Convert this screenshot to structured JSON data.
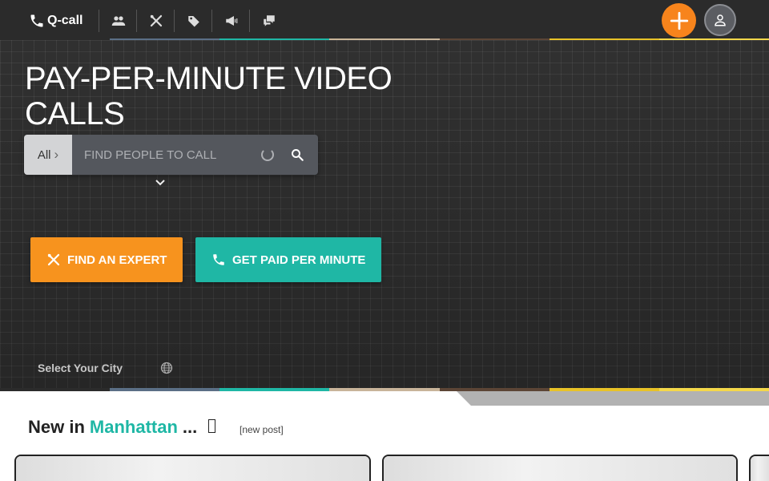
{
  "nav": {
    "brand_label": "Q-call",
    "icons": [
      "people-icon",
      "tools-icon",
      "tag-icon",
      "megaphone-icon",
      "chat-icon"
    ],
    "add_icon": "plus-icon",
    "user_icon": "user-icon"
  },
  "strip_colors": [
    "#2b2b2b",
    "#5b6f86",
    "#1fb7a5",
    "#c8b49a",
    "#5c4536",
    "#e8c227",
    "#f4d84a"
  ],
  "hero": {
    "title": "PAY-PER-MINUTE VIDEO CALLS",
    "search": {
      "scope_label": "All",
      "placeholder": "FIND PEOPLE TO CALL",
      "value": ""
    },
    "cta_expert_label": "FIND AN EXPERT",
    "cta_paid_label": "GET PAID PER MINUTE",
    "city_label": "Select Your City"
  },
  "listing": {
    "heading_prefix": "New in",
    "heading_city": "Manhattan",
    "heading_suffix": "...",
    "new_post_label": "[new post]"
  },
  "colors": {
    "accent_orange": "#f7931e",
    "accent_teal": "#1fb7a5",
    "nav_bg": "#2b2b2b"
  }
}
